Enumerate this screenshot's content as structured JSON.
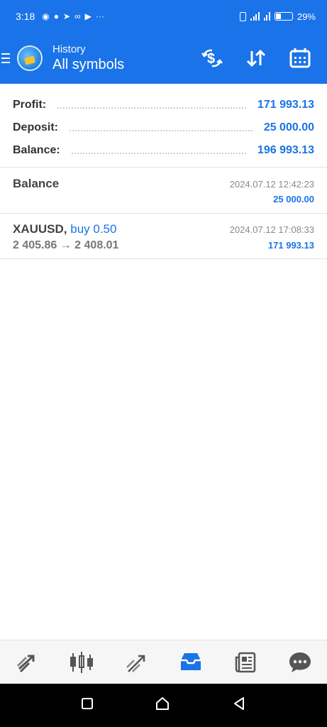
{
  "status_bar": {
    "time": "3:18",
    "battery_percent": "29%",
    "battery_level": 0.29
  },
  "header": {
    "title": "History",
    "subtitle": "All symbols",
    "icons": [
      "menu-icon",
      "app-logo",
      "deposit-withdraw-icon",
      "sort-icon",
      "calendar-icon"
    ]
  },
  "summary": {
    "profit_label": "Profit:",
    "profit_value": "171 993.13",
    "deposit_label": "Deposit:",
    "deposit_value": "25 000.00",
    "balance_label": "Balance:",
    "balance_value": "196 993.13"
  },
  "entries": [
    {
      "name": "Balance",
      "action": "",
      "datetime": "2024.07.12 12:42:23",
      "prices": "",
      "amount": "25 000.00"
    },
    {
      "name": "XAUUSD,",
      "action": "buy 0.50",
      "datetime": "2024.07.12 17:08:33",
      "prices": "2 405.86 → 2 408.01",
      "amount": "171 993.13"
    }
  ],
  "bottom_nav": [
    "quotes-icon",
    "chart-icon",
    "trade-icon",
    "history-icon",
    "news-icon",
    "chat-icon"
  ],
  "colors": {
    "accent": "#1a73e8",
    "header_bg": "#1a73e8",
    "text_dark": "#333333",
    "text_muted": "#8a8a8a"
  }
}
